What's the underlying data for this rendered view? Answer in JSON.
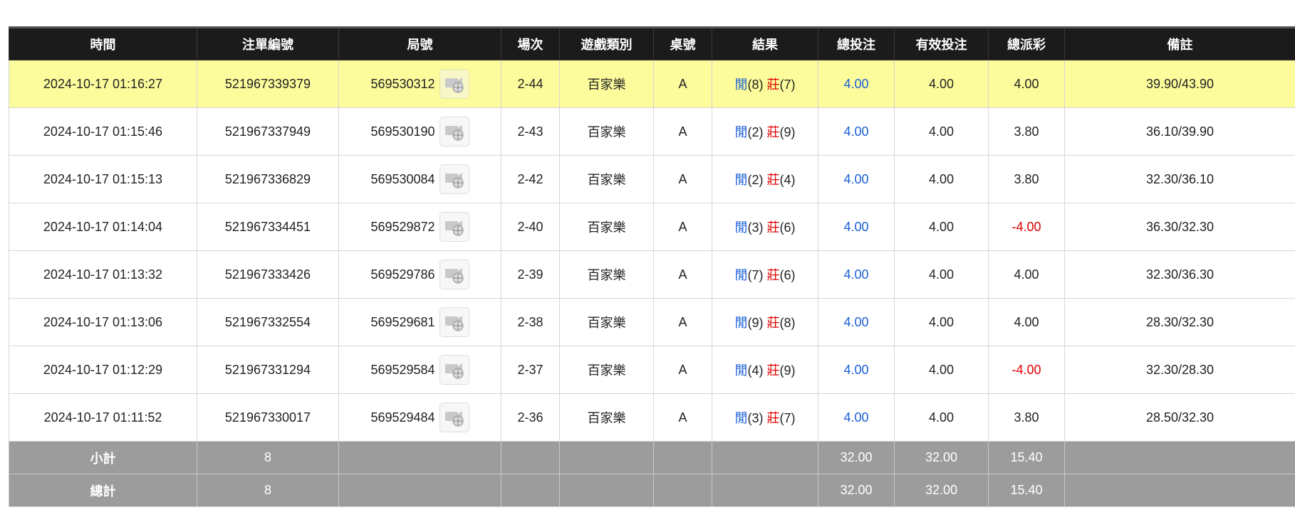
{
  "colors": {
    "header_bg": "#1b1b1b",
    "highlight_row": "#fcfc9c",
    "footer_bg": "#9c9c9c",
    "player": "#1a5fd6",
    "banker": "#e00000",
    "negative": "#e00000",
    "bet_amount": "#1a5fd6"
  },
  "table": {
    "headers": [
      "時間",
      "注單編號",
      "局號",
      "場次",
      "遊戲類別",
      "桌號",
      "結果",
      "總投注",
      "有效投注",
      "總派彩",
      "備註"
    ],
    "rows": [
      {
        "time": "2024-10-17 01:16:27",
        "order_id": "521967339379",
        "round_id": "569530312",
        "icon": "replay-video-icon",
        "session": "2-44",
        "game": "百家樂",
        "table": "A",
        "player_label": "閒",
        "player_score": "(8)",
        "banker_label": "莊",
        "banker_score": "(7)",
        "total_bet": "4.00",
        "valid_bet": "4.00",
        "payout": "4.00",
        "payout_negative": false,
        "note": "39.90/43.90",
        "highlight": true
      },
      {
        "time": "2024-10-17 01:15:46",
        "order_id": "521967337949",
        "round_id": "569530190",
        "icon": "replay-video-icon",
        "session": "2-43",
        "game": "百家樂",
        "table": "A",
        "player_label": "閒",
        "player_score": "(2)",
        "banker_label": "莊",
        "banker_score": "(9)",
        "total_bet": "4.00",
        "valid_bet": "4.00",
        "payout": "3.80",
        "payout_negative": false,
        "note": "36.10/39.90",
        "highlight": false
      },
      {
        "time": "2024-10-17 01:15:13",
        "order_id": "521967336829",
        "round_id": "569530084",
        "icon": "replay-video-icon",
        "session": "2-42",
        "game": "百家樂",
        "table": "A",
        "player_label": "閒",
        "player_score": "(2)",
        "banker_label": "莊",
        "banker_score": "(4)",
        "total_bet": "4.00",
        "valid_bet": "4.00",
        "payout": "3.80",
        "payout_negative": false,
        "note": "32.30/36.10",
        "highlight": false
      },
      {
        "time": "2024-10-17 01:14:04",
        "order_id": "521967334451",
        "round_id": "569529872",
        "icon": "replay-video-icon",
        "session": "2-40",
        "game": "百家樂",
        "table": "A",
        "player_label": "閒",
        "player_score": "(3)",
        "banker_label": "莊",
        "banker_score": "(6)",
        "total_bet": "4.00",
        "valid_bet": "4.00",
        "payout": "-4.00",
        "payout_negative": true,
        "note": "36.30/32.30",
        "highlight": false
      },
      {
        "time": "2024-10-17 01:13:32",
        "order_id": "521967333426",
        "round_id": "569529786",
        "icon": "replay-video-icon",
        "session": "2-39",
        "game": "百家樂",
        "table": "A",
        "player_label": "閒",
        "player_score": "(7)",
        "banker_label": "莊",
        "banker_score": "(6)",
        "total_bet": "4.00",
        "valid_bet": "4.00",
        "payout": "4.00",
        "payout_negative": false,
        "note": "32.30/36.30",
        "highlight": false
      },
      {
        "time": "2024-10-17 01:13:06",
        "order_id": "521967332554",
        "round_id": "569529681",
        "icon": "replay-video-icon",
        "session": "2-38",
        "game": "百家樂",
        "table": "A",
        "player_label": "閒",
        "player_score": "(9)",
        "banker_label": "莊",
        "banker_score": "(8)",
        "total_bet": "4.00",
        "valid_bet": "4.00",
        "payout": "4.00",
        "payout_negative": false,
        "note": "28.30/32.30",
        "highlight": false
      },
      {
        "time": "2024-10-17 01:12:29",
        "order_id": "521967331294",
        "round_id": "569529584",
        "icon": "replay-video-icon",
        "session": "2-37",
        "game": "百家樂",
        "table": "A",
        "player_label": "閒",
        "player_score": "(4)",
        "banker_label": "莊",
        "banker_score": "(9)",
        "total_bet": "4.00",
        "valid_bet": "4.00",
        "payout": "-4.00",
        "payout_negative": true,
        "note": "32.30/28.30",
        "highlight": false
      },
      {
        "time": "2024-10-17 01:11:52",
        "order_id": "521967330017",
        "round_id": "569529484",
        "icon": "replay-video-icon",
        "session": "2-36",
        "game": "百家樂",
        "table": "A",
        "player_label": "閒",
        "player_score": "(3)",
        "banker_label": "莊",
        "banker_score": "(7)",
        "total_bet": "4.00",
        "valid_bet": "4.00",
        "payout": "3.80",
        "payout_negative": false,
        "note": "28.50/32.30",
        "highlight": false
      }
    ],
    "subtotal": {
      "label": "小計",
      "count": "8",
      "total_bet": "32.00",
      "valid_bet": "32.00",
      "payout": "15.40"
    },
    "grand_total": {
      "label": "總計",
      "count": "8",
      "total_bet": "32.00",
      "valid_bet": "32.00",
      "payout": "15.40"
    }
  }
}
